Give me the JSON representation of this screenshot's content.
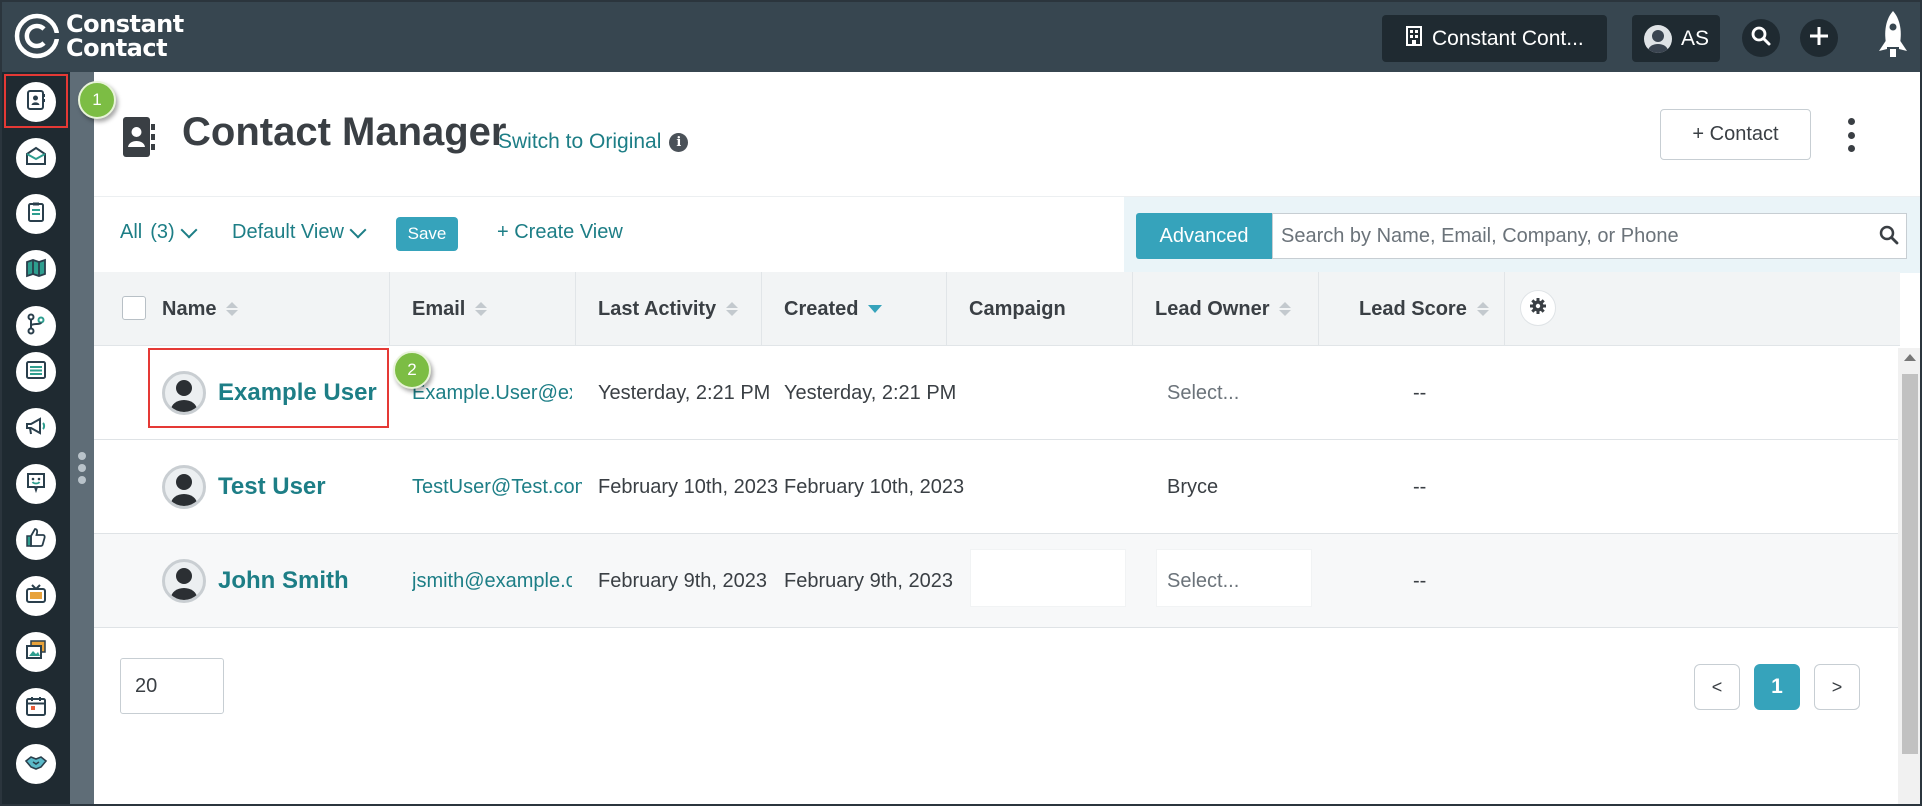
{
  "brand": {
    "line1": "Constant",
    "line2": "Contact"
  },
  "topbar": {
    "account_label": "Constant Cont...",
    "user_initials": "AS"
  },
  "rail": {
    "items": [
      "contacts",
      "email",
      "forms",
      "landing-pages",
      "automation",
      "lists",
      "campaigns",
      "surveys",
      "social",
      "ads",
      "images",
      "events",
      "partners"
    ]
  },
  "callouts": {
    "one": "1",
    "two": "2"
  },
  "header": {
    "title": "Contact Manager",
    "switch_label": "Switch to Original",
    "info": "i",
    "add_contact": "+ Contact"
  },
  "toolbar": {
    "filter_label": "All",
    "filter_count": "(3)",
    "view_label": "Default View",
    "save_label": "Save",
    "create_view": "+ Create View",
    "advanced_label": "Advanced",
    "search_placeholder": "Search by Name, Email, Company, or Phone"
  },
  "table": {
    "columns": {
      "name": "Name",
      "email": "Email",
      "last_activity": "Last Activity",
      "created": "Created",
      "campaign": "Campaign",
      "lead_owner": "Lead Owner",
      "lead_score": "Lead Score"
    },
    "rows": [
      {
        "name": "Example User",
        "email": "Example.User@exa...",
        "last_activity": "Yesterday, 2:21 PM",
        "created": "Yesterday, 2:21 PM",
        "campaign": "",
        "lead_owner": "Select...",
        "lead_score": "--"
      },
      {
        "name": "Test User",
        "email": "TestUser@Test.com",
        "last_activity": "February 10th, 2023",
        "created": "February 10th, 2023",
        "campaign": "",
        "lead_owner": "Bryce",
        "lead_score": "--"
      },
      {
        "name": "John Smith",
        "email": "jsmith@example.c...",
        "last_activity": "February 9th, 2023",
        "created": "February 9th, 2023",
        "campaign": "",
        "lead_owner": "Select...",
        "lead_score": "--"
      }
    ]
  },
  "footer": {
    "per_page": "20",
    "prev": "<",
    "current_page": "1",
    "next": ">"
  },
  "colors": {
    "topbar": "#374650",
    "rail": "#1f2a31",
    "accent": "#36a3bb",
    "link": "#1d7e86",
    "callout": "#7cbd44",
    "highlight": "#e53935"
  }
}
